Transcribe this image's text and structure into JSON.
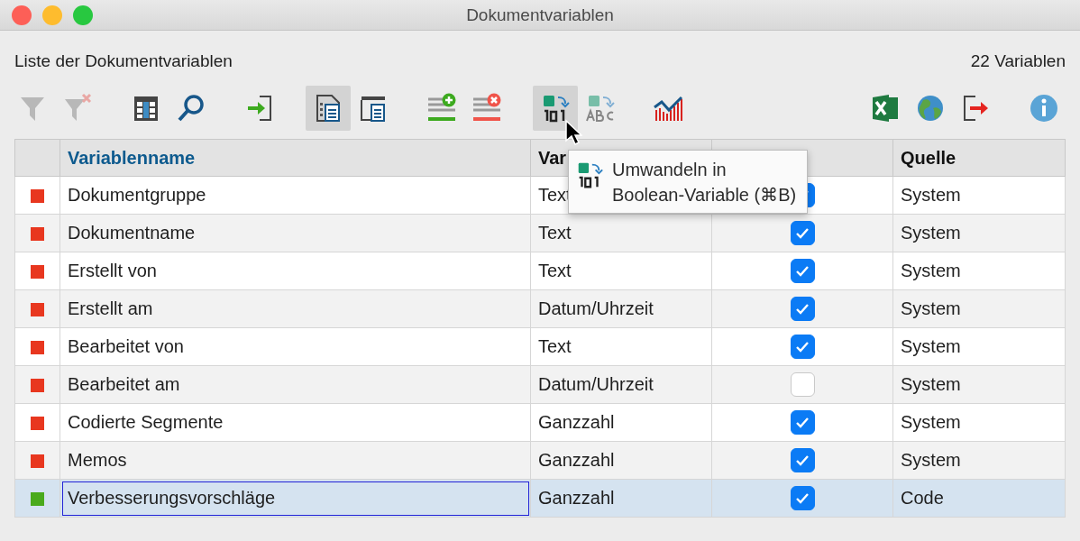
{
  "window": {
    "title": "Dokumentvariablen"
  },
  "header": {
    "title": "Liste der Dokumentvariablen",
    "count": "22 Variablen"
  },
  "toolbar": {
    "left": [
      {
        "items": [
          {
            "kind": "filter",
            "disabled": true,
            "selected": false
          },
          {
            "kind": "filter-clear",
            "disabled": true,
            "selected": false
          }
        ]
      },
      {
        "items": [
          {
            "kind": "columns",
            "disabled": false,
            "selected": false
          },
          {
            "kind": "search",
            "disabled": false,
            "selected": false
          }
        ]
      },
      {
        "items": [
          {
            "kind": "import",
            "disabled": false,
            "selected": false
          }
        ]
      },
      {
        "items": [
          {
            "kind": "doc-list",
            "disabled": false,
            "selected": true
          },
          {
            "kind": "doc-window",
            "disabled": false,
            "selected": false
          }
        ]
      },
      {
        "items": [
          {
            "kind": "add-row",
            "disabled": false,
            "selected": false
          },
          {
            "kind": "delete-row",
            "disabled": false,
            "selected": false
          }
        ]
      },
      {
        "items": [
          {
            "kind": "to-boolean",
            "disabled": false,
            "selected": true
          },
          {
            "kind": "to-text",
            "disabled": true,
            "selected": false
          }
        ]
      },
      {
        "items": [
          {
            "kind": "chart",
            "disabled": false,
            "selected": false
          }
        ]
      }
    ],
    "right": [
      {
        "items": [
          {
            "kind": "excel",
            "disabled": false,
            "selected": false
          },
          {
            "kind": "globe",
            "disabled": false,
            "selected": false
          },
          {
            "kind": "export",
            "disabled": false,
            "selected": false
          }
        ]
      },
      {
        "items": [
          {
            "kind": "info",
            "disabled": false,
            "selected": false
          }
        ]
      }
    ]
  },
  "table": {
    "columns": [
      {
        "label": "Variablenname",
        "highlighted": true
      },
      {
        "label": "Var",
        "highlighted": false
      },
      {},
      {
        "label": "Quelle",
        "highlighted": false
      }
    ],
    "rows": [
      {
        "color": "#e8371f",
        "name": "Dokumentgruppe",
        "type": "Text",
        "visible": true,
        "source": "System",
        "selected": false
      },
      {
        "color": "#e8371f",
        "name": "Dokumentname",
        "type": "Text",
        "visible": true,
        "source": "System",
        "selected": false
      },
      {
        "color": "#e8371f",
        "name": "Erstellt von",
        "type": "Text",
        "visible": true,
        "source": "System",
        "selected": false
      },
      {
        "color": "#e8371f",
        "name": "Erstellt am",
        "type": "Datum/Uhrzeit",
        "visible": true,
        "source": "System",
        "selected": false
      },
      {
        "color": "#e8371f",
        "name": "Bearbeitet von",
        "type": "Text",
        "visible": true,
        "source": "System",
        "selected": false
      },
      {
        "color": "#e8371f",
        "name": "Bearbeitet am",
        "type": "Datum/Uhrzeit",
        "visible": false,
        "source": "System",
        "selected": false
      },
      {
        "color": "#e8371f",
        "name": "Codierte Segmente",
        "type": "Ganzzahl",
        "visible": true,
        "source": "System",
        "selected": false
      },
      {
        "color": "#e8371f",
        "name": "Memos",
        "type": "Ganzzahl",
        "visible": true,
        "source": "System",
        "selected": false
      },
      {
        "color": "#4aaa1c",
        "name": "Verbesserungsvorschläge",
        "type": "Ganzzahl",
        "visible": true,
        "source": "Code",
        "selected": true
      }
    ]
  },
  "tooltip": {
    "lines": [
      "Umwandeln in",
      "Boolean-Variable (⌘B)"
    ]
  }
}
